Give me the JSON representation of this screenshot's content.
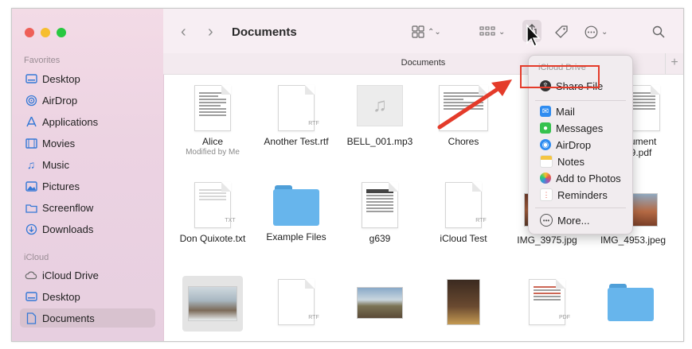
{
  "window": {
    "title": "Documents",
    "path_label": "Documents",
    "new_tab": "+"
  },
  "sidebar": {
    "favorites_label": "Favorites",
    "favorites": [
      {
        "label": "Desktop",
        "icon": "desktop-icon"
      },
      {
        "label": "AirDrop",
        "icon": "airdrop-icon"
      },
      {
        "label": "Applications",
        "icon": "applications-icon"
      },
      {
        "label": "Movies",
        "icon": "movies-icon"
      },
      {
        "label": "Music",
        "icon": "music-icon"
      },
      {
        "label": "Pictures",
        "icon": "pictures-icon"
      },
      {
        "label": "Screenflow",
        "icon": "folder-icon"
      },
      {
        "label": "Downloads",
        "icon": "downloads-icon"
      }
    ],
    "icloud_label": "iCloud",
    "icloud": [
      {
        "label": "iCloud Drive",
        "icon": "cloud-icon"
      },
      {
        "label": "Desktop",
        "icon": "desktop-icon"
      },
      {
        "label": "Documents",
        "icon": "document-icon",
        "selected": true
      }
    ]
  },
  "files": {
    "row1": [
      {
        "name": "Alice",
        "sub": "Modified by Me",
        "kind": "document-scan"
      },
      {
        "name": "Another Test.rtf",
        "kind": "rtf",
        "ext": "RTF"
      },
      {
        "name": "BELL_001.mp3",
        "kind": "audio"
      },
      {
        "name": "Chores",
        "kind": "spreadsheet"
      },
      {
        "name": "Document…39.pdf",
        "kind": "pdf"
      }
    ],
    "row1_partial_name_line1": "cument",
    "row1_partial_name_line2": "39.pdf",
    "row2": [
      {
        "name": "Don Quixote.txt",
        "kind": "txt",
        "ext": "TXT"
      },
      {
        "name": "Example Files",
        "kind": "folder"
      },
      {
        "name": "g639",
        "kind": "document-scan"
      },
      {
        "name": "iCloud Test",
        "kind": "rtf",
        "ext": "RTF"
      },
      {
        "name": "IMG_3975.jpg",
        "kind": "photo"
      },
      {
        "name": "IMG_4953.jpeg",
        "kind": "photo"
      }
    ],
    "row3_ext": [
      "RTF",
      "PDF"
    ]
  },
  "share_menu": {
    "header": "iCloud Drive",
    "share_file": "Share File",
    "items": [
      {
        "label": "Mail",
        "icon": "mail-icon",
        "color": "#2f8cf0"
      },
      {
        "label": "Messages",
        "icon": "messages-icon",
        "color": "#36c24f"
      },
      {
        "label": "AirDrop",
        "icon": "airdrop-icon",
        "color": "#2f8cf0"
      },
      {
        "label": "Notes",
        "icon": "notes-icon",
        "color": "#f5c542"
      },
      {
        "label": "Add to Photos",
        "icon": "photos-icon",
        "color": "#e6584c"
      },
      {
        "label": "Reminders",
        "icon": "reminders-icon",
        "color": "#ffffff"
      }
    ],
    "more": "More..."
  },
  "colors": {
    "accent": "#e43b2a",
    "sidebar": "#ecd3e2",
    "traffic_close": "#ee5f57",
    "traffic_min": "#f6be2f",
    "traffic_max": "#28c840"
  }
}
